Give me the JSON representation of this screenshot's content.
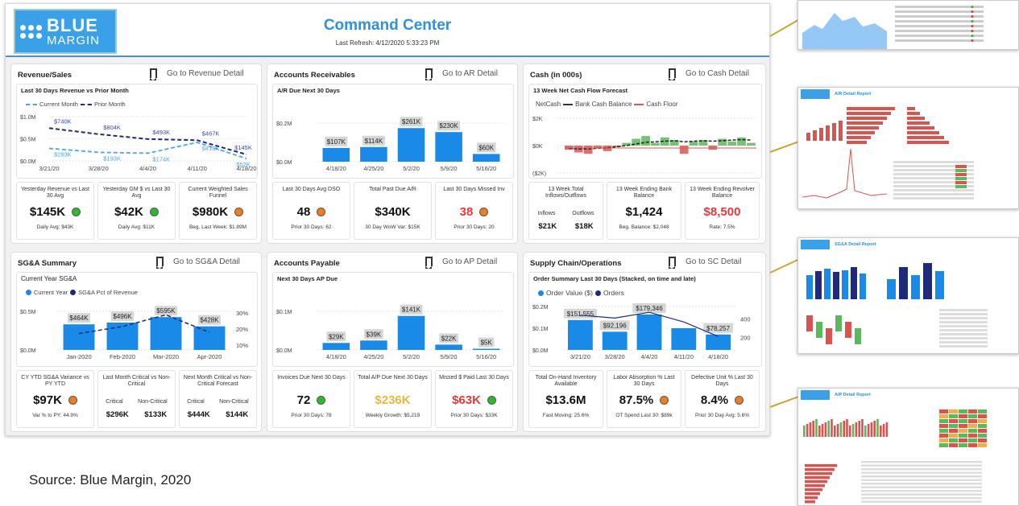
{
  "header": {
    "logo_line1": "BLUE",
    "logo_line2": "MARGIN",
    "title": "Command Center",
    "refresh": "Last Refresh: 4/12/2020 5:33:23 PM"
  },
  "goto_icon": "bookmark-icon",
  "colors": {
    "accent": "#2f8fe0",
    "bar": "#1a8ae8",
    "dark_series": "#1f2a7a",
    "good": "#2eb82e",
    "warn": "#f07d21",
    "alert": "#e23a3a",
    "gold": "#e8b83a",
    "connector": "#c8a638"
  },
  "cards": {
    "revenue": {
      "title": "Revenue/Sales",
      "goto": "Go to Revenue Detail",
      "chart_title": "Last 30 Days Revenue vs Prior Month",
      "legend": [
        "Current Month",
        "Prior Month"
      ],
      "kpis": [
        {
          "title": "Yesterday Revenue vs Last 30 Avg",
          "value": "$145K",
          "status": "green",
          "sub": "Daily Avg: $43K"
        },
        {
          "title": "Yesterday GM $ vs Last 30 Avg",
          "value": "$42K",
          "status": "green",
          "sub": "Daily Avg: $11K"
        },
        {
          "title": "Current Weighted Sales Funnel",
          "value": "$980K",
          "status": "orange",
          "sub": "Beg. Last Week: $1.89M"
        }
      ]
    },
    "ar": {
      "title": "Accounts Receivables",
      "goto": "Go to AR Detail",
      "chart_title": "A/R Due Next 30 Days",
      "kpis": [
        {
          "title": "Last 30 Days Avg DSO",
          "value": "48",
          "status": "orange",
          "sub": "Prior 30 Days: 62"
        },
        {
          "title": "Total Past Due A/R",
          "value": "$340K",
          "status": "",
          "sub": "30 Day WoW Var: $15K"
        },
        {
          "title": "Last 30 Days Missed Inv",
          "value": "38",
          "status": "orange",
          "sub": "Prior 30 Days: 20"
        }
      ]
    },
    "cash": {
      "title": "Cash (in 000s)",
      "goto": "Go to Cash Detail",
      "chart_title": "13 Week Net Cash Flow Forecast",
      "legend": [
        "NetCash",
        "Bank Cash Balance",
        "Cash Floor"
      ],
      "k1": {
        "title": "13 Week Total Inflows/Outflows",
        "l1": "Inflows",
        "l2": "Outflows",
        "v1": "$21K",
        "v2": "$18K"
      },
      "k2": {
        "title": "13 Week Ending Bank Balance",
        "value": "$1,424",
        "sub": "Beg. Balance: $2,048"
      },
      "k3": {
        "title": "13 Week Ending Revolver Balance",
        "value": "$8,500",
        "sub": "Rate: 7.5%"
      }
    },
    "sga": {
      "title": "SG&A Summary",
      "goto": "Go to SG&A Detail",
      "chart_title": "Current Year SG&A",
      "legend": [
        "Current Year",
        "SG&A Pct of Revenue"
      ],
      "k1": {
        "title": "CY YTD SG&A Variance vs PY YTD",
        "value": "$97K",
        "status": "orange",
        "sub": "Var % to PY: 44.9%"
      },
      "k2": {
        "title": "Last Month Critical vs Non-Critical",
        "l1": "Critical",
        "l2": "Non-Critical",
        "v1": "$296K",
        "v2": "$133K"
      },
      "k3": {
        "title": "Next Month Critical vs Non-Critical Forecast",
        "l1": "Critical",
        "l2": "Non-Critical",
        "v1": "$444K",
        "v2": "$144K"
      }
    },
    "ap": {
      "title": "Accounts Payable",
      "goto": "Go to AP Detail",
      "chart_title": "Next 30 Days AP Due",
      "kpis": [
        {
          "title": "Invoices Due Next 30 Days",
          "value": "72",
          "status": "green",
          "sub": "Prior 30 Days: 78"
        },
        {
          "title": "Total A/P Due Next 30 Days",
          "value": "$236K",
          "status": "",
          "sub": "Weekly Growth: $5,219"
        },
        {
          "title": "Missed $ Paid Last 30 Days",
          "value": "$63K",
          "status": "green",
          "sub": "Prior 30 Days: $33K"
        }
      ]
    },
    "sc": {
      "title": "Supply Chain/Operations",
      "goto": "Go to SC Detail",
      "chart_title": "Order Summary Last 30 Days (Stacked, on time and late)",
      "legend": [
        "Order Value ($)",
        "Orders"
      ],
      "kpis": [
        {
          "title": "Total On-Hand Inventory Available",
          "value": "$13.6M",
          "status": "",
          "sub": "Fast Moving: 25.6%"
        },
        {
          "title": "Labor Absorption % Last 30 Days",
          "value": "87.5%",
          "status": "orange",
          "sub": "OT Spend Last 30: $89k"
        },
        {
          "title": "Defective Unit % Last 30 Days",
          "value": "8.4%",
          "status": "orange",
          "sub": "Prior 30 Day Avg: 5.6%"
        }
      ]
    }
  },
  "chart_data": [
    {
      "id": "revenue",
      "type": "line",
      "categories": [
        "3/21/20",
        "3/28/20",
        "4/4/20",
        "4/11/20",
        "4/18/20"
      ],
      "yticks": [
        "$0.0M",
        "$0.5M",
        "$1.0M"
      ],
      "ylim": [
        0,
        1.0
      ],
      "series": [
        {
          "name": "Current Month",
          "values": [
            0.283,
            0.193,
            0.174,
            0.418,
            0.052
          ],
          "labels": [
            "$283K",
            "$193K",
            "$174K",
            "$418K",
            "$52K"
          ]
        },
        {
          "name": "Prior Month",
          "values": [
            0.74,
            0.604,
            0.493,
            0.467,
            0.145
          ],
          "labels": [
            "$740K",
            "$804K",
            "$493K",
            "$467K",
            "$145K"
          ]
        }
      ]
    },
    {
      "id": "ar",
      "type": "bar",
      "categories": [
        "4/18/20",
        "4/25/20",
        "5/2/20",
        "5/9/20",
        "5/16/20"
      ],
      "values": [
        107,
        114,
        261,
        230,
        60
      ],
      "labels": [
        "$107K",
        "$114K",
        "$261K",
        "$230K",
        "$60K"
      ],
      "yticks": [
        "$0.0M",
        "$0.2M"
      ],
      "ylim": [
        0,
        300
      ]
    },
    {
      "id": "cash",
      "type": "bar",
      "yticks": [
        "($2K)",
        "$0K",
        "$2K"
      ],
      "ylim": [
        -2,
        2
      ],
      "values": [
        -0.3,
        -0.5,
        -0.6,
        -0.2,
        -0.4,
        -0.1,
        0.2,
        0.5,
        0.7,
        0.2,
        0.6,
        0.4,
        -0.6,
        0.3,
        0.4,
        -0.3,
        0.5,
        0.3,
        0.6,
        0.2
      ],
      "series": [
        {
          "name": "Bank Cash Balance",
          "values": [
            -0.5,
            -0.6,
            -0.6,
            -0.5,
            -0.4,
            -0.2,
            0.0,
            0.3,
            0.6,
            0.7,
            0.8,
            0.9,
            0.7,
            0.8,
            0.9,
            0.8,
            0.9,
            1.0,
            1.1,
            1.0
          ]
        }
      ]
    },
    {
      "id": "sga",
      "type": "bar",
      "categories": [
        "Jan-2020",
        "Feb-2020",
        "Mar-2020",
        "Apr-2020"
      ],
      "values": [
        464,
        496,
        595,
        428
      ],
      "labels": [
        "$464K",
        "$496K",
        "$595K",
        "$428K"
      ],
      "yticks": [
        "$0.0M",
        "$0.5M"
      ],
      "y2ticks": [
        "10%",
        "20%",
        "30%"
      ],
      "ylim": [
        0,
        700
      ],
      "series": [
        {
          "name": "SG&A Pct of Revenue",
          "values": [
            0.14,
            0.2,
            0.3,
            0.15
          ]
        }
      ]
    },
    {
      "id": "ap",
      "type": "bar",
      "categories": [
        "4/18/20",
        "4/25/20",
        "5/2/20",
        "5/9/20",
        "5/16/20"
      ],
      "values": [
        29,
        39,
        141,
        22,
        5
      ],
      "labels": [
        "$29K",
        "$39K",
        "$141K",
        "$22K",
        "$5K"
      ],
      "yticks": [
        "$0.0M",
        "$0.1M"
      ],
      "ylim": [
        0,
        160
      ]
    },
    {
      "id": "sc",
      "type": "bar",
      "categories": [
        "3/21/20",
        "3/28/20",
        "4/4/20",
        "4/11/20",
        "4/18/20"
      ],
      "values": [
        151555,
        92196,
        179346,
        110000,
        78257
      ],
      "labels": [
        "$151,555",
        "$92,196",
        "$179,346",
        "",
        "$78,257"
      ],
      "yticks": [
        "$0.0M",
        "$0.1M",
        "$0.2M"
      ],
      "y2ticks": [
        "200",
        "400"
      ],
      "ylim": [
        0,
        220000
      ],
      "series": [
        {
          "name": "Orders",
          "values": [
            360,
            330,
            390,
            290,
            140
          ]
        }
      ]
    }
  ],
  "thumbnails": [
    {
      "title": ""
    },
    {
      "title": "A/R Detail Report"
    },
    {
      "title": "SG&A Detail Report"
    },
    {
      "title": "A/P Detail Report"
    }
  ],
  "source": "Source: Blue Margin, 2020"
}
